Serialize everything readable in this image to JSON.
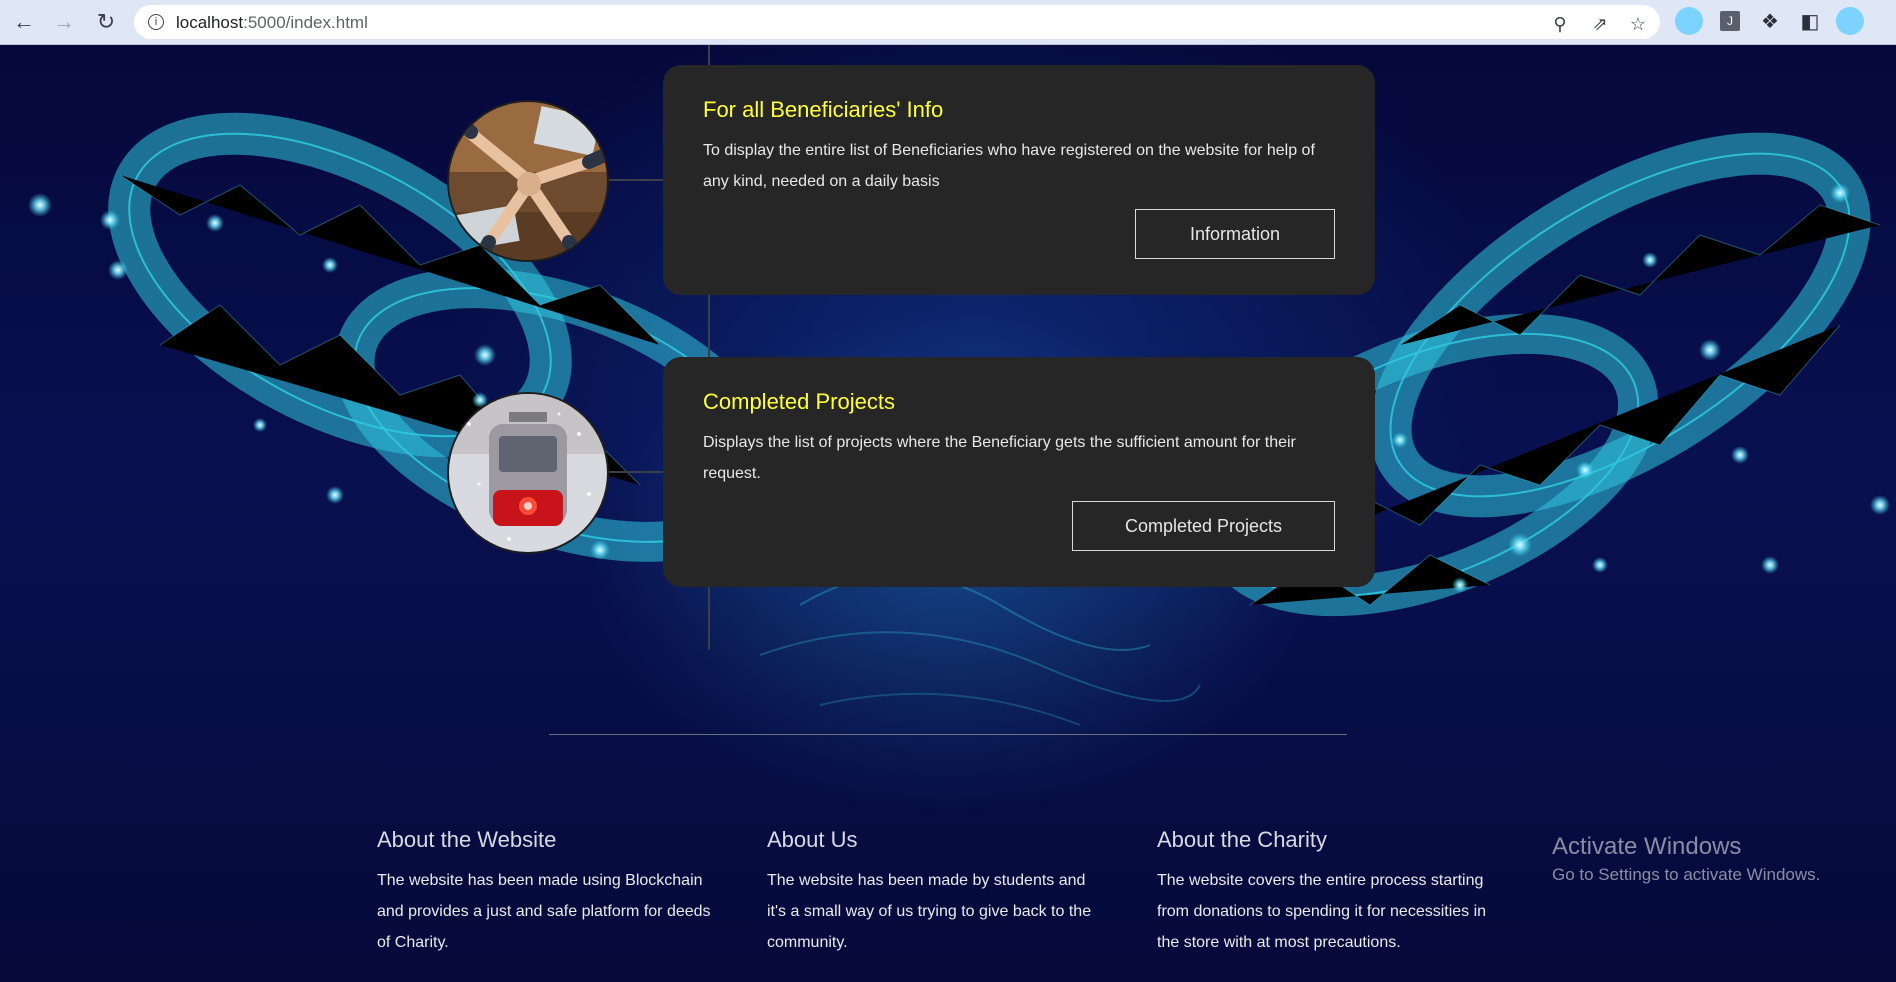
{
  "browser": {
    "url_host": "localhost",
    "url_path": ":5000/index.html"
  },
  "timeline": [
    {
      "title": "For all Beneficiaries' Info",
      "description": "To display the entire list of Beneficiaries who have registered on the website for help of any kind, needed on a daily basis",
      "button": "Information"
    },
    {
      "title": "Completed Projects",
      "description": "Displays the list of projects where the Beneficiary gets the sufficient amount for their request.",
      "button": "Completed Projects"
    }
  ],
  "footer": [
    {
      "heading": "About the Website",
      "text": "The website has been made using Blockchain and provides a just and safe platform for deeds of Charity."
    },
    {
      "heading": "About Us",
      "text": "The website has been made by students and it's a small way of us trying to give back to the community."
    },
    {
      "heading": "About the Charity",
      "text": "The website covers the entire process starting from donations to spending it for necessities in the store with at most precautions."
    }
  ],
  "watermark": {
    "line1": "Activate Windows",
    "line2": "Go to Settings to activate Windows."
  },
  "colors": {
    "card_title": "#ffff3b",
    "card_bg": "#262626",
    "page_bg": "#060a38",
    "chain_glow": "#2fd0e6"
  }
}
